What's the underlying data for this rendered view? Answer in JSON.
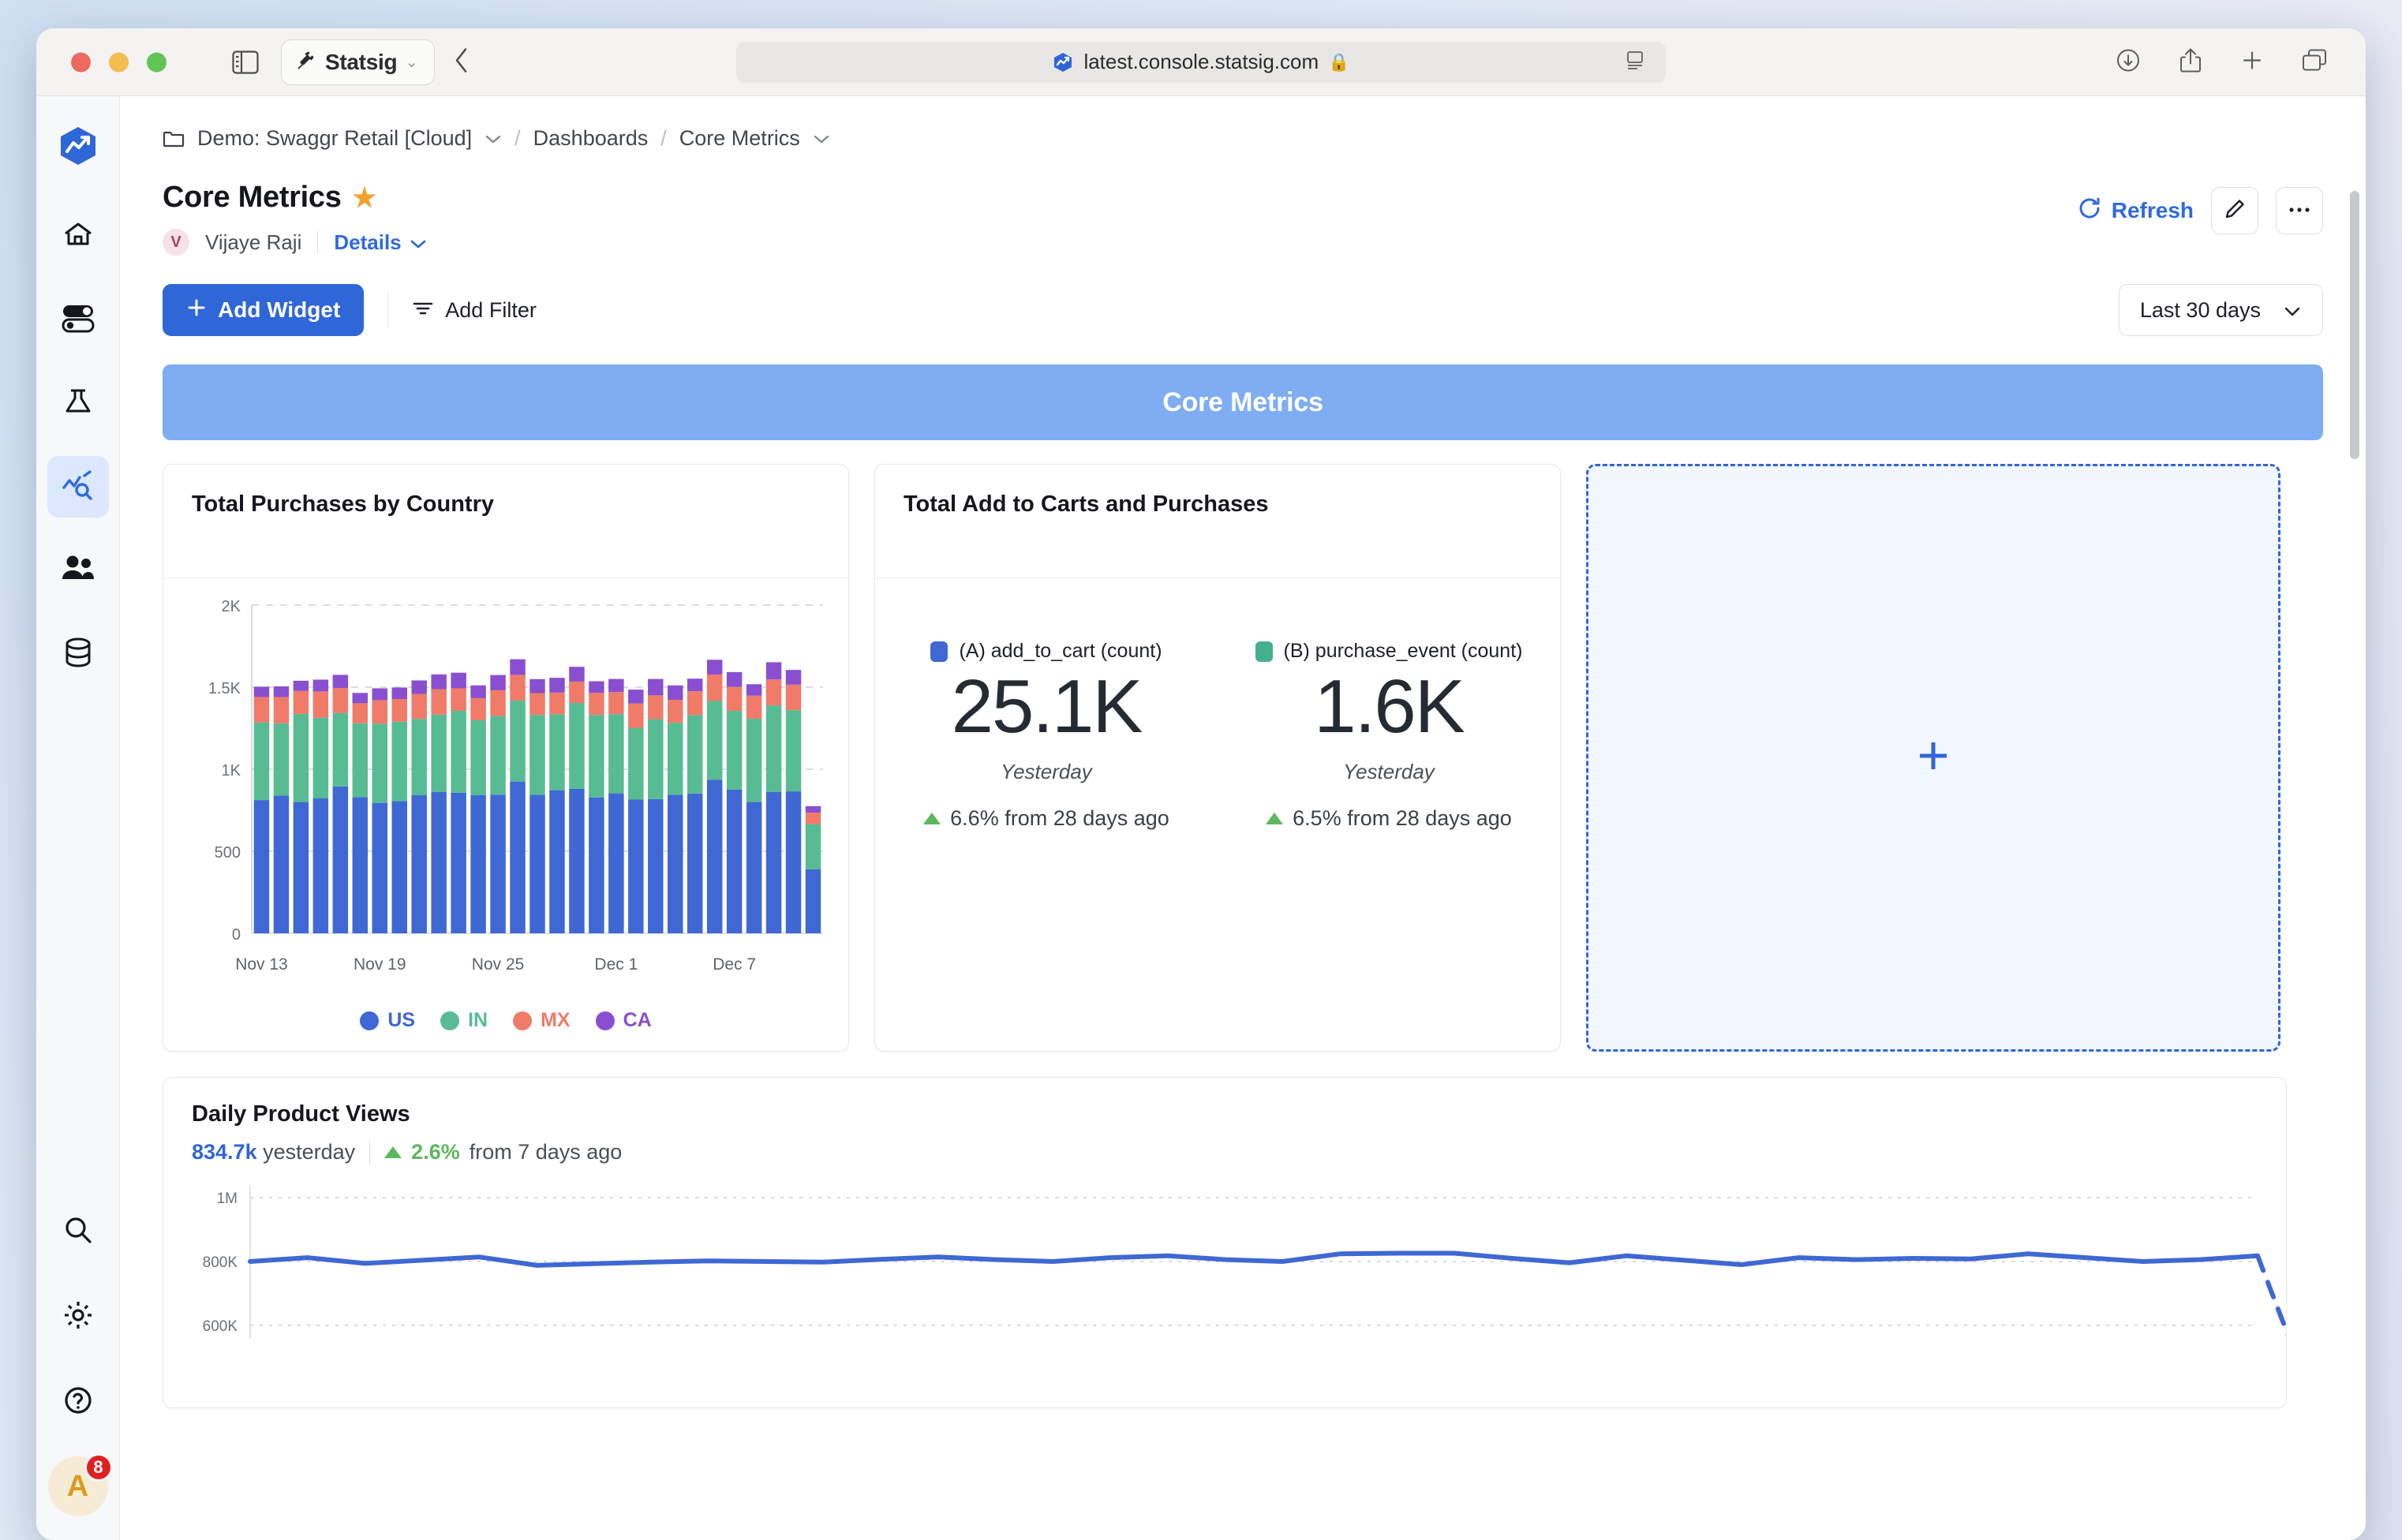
{
  "browser": {
    "profile_label": "Statsig",
    "url": "latest.console.statsig.com",
    "icons": {
      "sidebar_toggle": "sidebar-toggle-icon",
      "back": "back-chevron-icon",
      "lock": "lock-icon",
      "reader": "reader-view-icon",
      "download": "download-icon",
      "share": "share-icon",
      "new_tab": "plus-icon",
      "tabs": "tab-overview-icon"
    }
  },
  "rail": {
    "items": [
      {
        "name": "logo",
        "icon": "statsig-logo-icon",
        "active": false
      },
      {
        "name": "home",
        "icon": "home-icon",
        "active": false
      },
      {
        "name": "feature-gates",
        "icon": "toggles-icon",
        "active": false
      },
      {
        "name": "experiments",
        "icon": "flask-icon",
        "active": false
      },
      {
        "name": "metrics",
        "icon": "metrics-chart-icon",
        "active": true
      },
      {
        "name": "people",
        "icon": "people-icon",
        "active": false
      },
      {
        "name": "data",
        "icon": "database-icon",
        "active": false
      }
    ],
    "bottom": [
      {
        "name": "search",
        "icon": "search-icon"
      },
      {
        "name": "settings",
        "icon": "gear-icon"
      },
      {
        "name": "help",
        "icon": "question-circle-icon"
      }
    ],
    "avatar": {
      "initial": "A",
      "badge": "8"
    }
  },
  "breadcrumb": {
    "project": "Demo: Swaggr Retail [Cloud]",
    "section": "Dashboards",
    "page": "Core Metrics"
  },
  "header": {
    "title": "Core Metrics",
    "owner": "Vijaye Raji",
    "owner_initial": "V",
    "details_label": "Details",
    "refresh_label": "Refresh",
    "edit_icon": "pencil-icon",
    "more_icon": "ellipsis-icon",
    "star_icon": "star-icon"
  },
  "toolbar": {
    "add_widget_label": "Add Widget",
    "add_filter_label": "Add Filter",
    "date_range_label": "Last 30 days"
  },
  "banner": {
    "label": "Core Metrics",
    "color": "#7eadf2"
  },
  "widgets": {
    "purchases_by_country": {
      "title": "Total Purchases by Country"
    },
    "carts_and_purchases": {
      "title": "Total Add to Carts and Purchases",
      "kpis": [
        {
          "legend": "(A) add_to_cart (count)",
          "color": "#3f68d4",
          "value": "25.1K",
          "period": "Yesterday",
          "delta": "6.6% from 28 days ago",
          "direction": "up"
        },
        {
          "legend": "(B) purchase_event (count)",
          "color": "#43b08a",
          "value": "1.6K",
          "period": "Yesterday",
          "delta": "6.5% from 28 days ago",
          "direction": "up"
        }
      ]
    },
    "empty_slot": {
      "icon": "plus-icon"
    },
    "daily_product_views": {
      "title": "Daily Product Views",
      "value": "834.7k",
      "value_suffix": "yesterday",
      "delta": "2.6%",
      "delta_suffix": "from 7 days ago",
      "direction": "up"
    }
  },
  "chart_data": [
    {
      "id": "purchases_by_country",
      "type": "bar",
      "stacked": true,
      "title": "Total Purchases by Country",
      "xlabel": "",
      "ylabel": "",
      "ylim": [
        0,
        2000
      ],
      "ytick_labels": [
        "0",
        "500",
        "1K",
        "1.5K",
        "2K"
      ],
      "yticks": [
        0,
        500,
        1000,
        1500,
        2000
      ],
      "grid": true,
      "legend_position": "bottom",
      "xtick_labels": [
        "Nov 13",
        "Nov 19",
        "Nov 25",
        "Dec 1",
        "Dec 7"
      ],
      "xtick_indices": [
        0,
        6,
        12,
        18,
        24
      ],
      "categories": [
        "Nov 13",
        "Nov 14",
        "Nov 15",
        "Nov 16",
        "Nov 17",
        "Nov 18",
        "Nov 19",
        "Nov 20",
        "Nov 21",
        "Nov 22",
        "Nov 23",
        "Nov 24",
        "Nov 25",
        "Nov 26",
        "Nov 27",
        "Nov 28",
        "Nov 29",
        "Nov 30",
        "Dec 1",
        "Dec 2",
        "Dec 3",
        "Dec 4",
        "Dec 5",
        "Dec 6",
        "Dec 7",
        "Dec 8",
        "Dec 9",
        "Dec 10",
        "Dec 11"
      ],
      "series": [
        {
          "name": "US",
          "color": "#3f68d4",
          "values": [
            812,
            840,
            800,
            822,
            895,
            830,
            795,
            805,
            843,
            862,
            856,
            843,
            845,
            925,
            845,
            872,
            880,
            828,
            853,
            815,
            818,
            845,
            852,
            935,
            875,
            800,
            862,
            865,
            390
          ]
        },
        {
          "name": "IN",
          "color": "#57bc93",
          "values": [
            473,
            440,
            537,
            492,
            448,
            450,
            483,
            485,
            464,
            471,
            500,
            455,
            479,
            493,
            486,
            463,
            524,
            503,
            483,
            437,
            487,
            438,
            478,
            481,
            481,
            508,
            527,
            495,
            275
          ]
        },
        {
          "name": "MX",
          "color": "#f07b68",
          "values": [
            155,
            160,
            140,
            160,
            152,
            122,
            143,
            138,
            152,
            155,
            137,
            135,
            157,
            157,
            133,
            132,
            130,
            135,
            134,
            148,
            145,
            140,
            145,
            161,
            146,
            140,
            158,
            155,
            70
          ]
        },
        {
          "name": "CA",
          "color": "#8a4fd0",
          "values": [
            63,
            65,
            62,
            72,
            80,
            63,
            72,
            70,
            82,
            90,
            95,
            78,
            93,
            95,
            85,
            90,
            90,
            70,
            80,
            85,
            100,
            88,
            77,
            90,
            90,
            70,
            105,
            90,
            40
          ]
        }
      ]
    },
    {
      "id": "daily_product_views",
      "type": "line",
      "title": "Daily Product Views",
      "ylim": [
        560000,
        1040000
      ],
      "ytick_labels": [
        "600K",
        "800K",
        "1M"
      ],
      "yticks": [
        600000,
        800000,
        1000000
      ],
      "grid": true,
      "line_color": "#3f68d4",
      "values": [
        800000,
        812000,
        794000,
        804000,
        814000,
        788000,
        793000,
        798000,
        802000,
        800000,
        798000,
        807000,
        814000,
        806000,
        800000,
        812000,
        818000,
        806000,
        800000,
        824000,
        826000,
        826000,
        810000,
        796000,
        818000,
        804000,
        790000,
        812000,
        806000,
        810000,
        808000,
        824000,
        812000,
        800000,
        806000,
        818000
      ],
      "projected_last_value": 560000,
      "projected_dashed": true
    }
  ]
}
